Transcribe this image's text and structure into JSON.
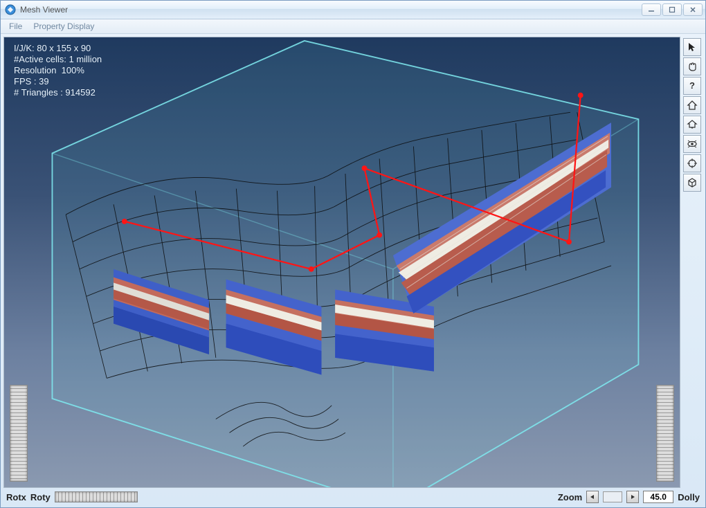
{
  "window": {
    "title": "Mesh Viewer"
  },
  "menu": {
    "file": "File",
    "property_display": "Property Display"
  },
  "hud": {
    "line1": "I/J/K: 80 x 155 x 90",
    "line2": "#Active cells: 1 million",
    "line3": "Resolution  100%",
    "line4": "FPS : 39",
    "line5": "# Triangles : 914592"
  },
  "bottom": {
    "rotx": "Rotx",
    "roty": "Roty",
    "zoom_label": "Zoom",
    "zoom_value": "45.0",
    "dolly": "Dolly"
  }
}
